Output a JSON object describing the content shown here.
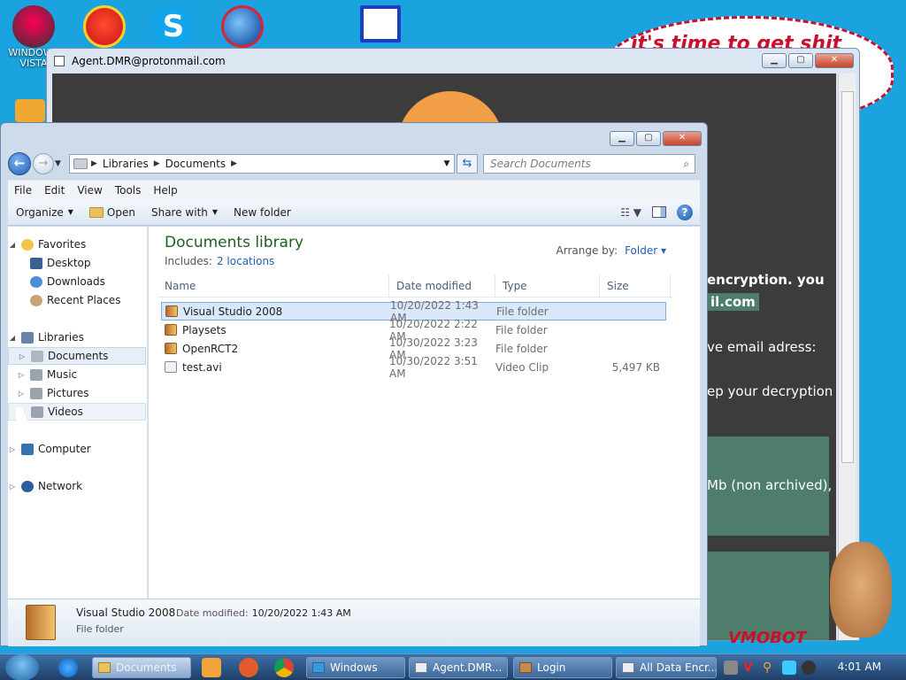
{
  "desktop": {
    "icons": [
      {
        "label": "WINDOWS VISTA"
      }
    ],
    "bubble_text": "it's time to get shit"
  },
  "ransom_window": {
    "title": "Agent.DMR@protonmail.com",
    "lines": [
      {
        "text": "encryption. you",
        "bold": true
      },
      {
        "text": "il.com",
        "bold": true
      },
      {
        "text": "ve email adress:"
      },
      {
        "text": "ep your decryption"
      },
      {
        "text": "Mb (non archived),"
      }
    ],
    "watermark": "VMOBOT"
  },
  "explorer": {
    "address": {
      "segments": [
        "Libraries",
        "Documents"
      ]
    },
    "search_placeholder": "Search Documents",
    "menu": [
      "File",
      "Edit",
      "View",
      "Tools",
      "Help"
    ],
    "commands": {
      "organize": "Organize",
      "open": "Open",
      "share": "Share with",
      "new_folder": "New folder"
    },
    "nav": {
      "favorites": "Favorites",
      "desktop": "Desktop",
      "downloads": "Downloads",
      "recent": "Recent Places",
      "libraries": "Libraries",
      "documents": "Documents",
      "music": "Music",
      "pictures": "Pictures",
      "videos": "Videos",
      "computer": "Computer",
      "network": "Network"
    },
    "library": {
      "title": "Documents library",
      "includes_label": "Includes:",
      "includes_link": "2 locations",
      "arrange_label": "Arrange by:",
      "arrange_value": "Folder"
    },
    "columns": [
      "Name",
      "Date modified",
      "Type",
      "Size"
    ],
    "files": [
      {
        "name": "Visual Studio 2008",
        "date": "10/20/2022 1:43 AM",
        "type": "File folder",
        "size": "",
        "kind": "folder"
      },
      {
        "name": "Playsets",
        "date": "10/20/2022 2:22 AM",
        "type": "File folder",
        "size": "",
        "kind": "folder"
      },
      {
        "name": "OpenRCT2",
        "date": "10/30/2022 3:23 AM",
        "type": "File folder",
        "size": "",
        "kind": "folder"
      },
      {
        "name": "test.avi",
        "date": "10/30/2022 3:51 AM",
        "type": "Video Clip",
        "size": "5,497 KB",
        "kind": "video"
      }
    ],
    "details": {
      "name": "Visual Studio 2008",
      "date_label": "Date modified:",
      "date_value": "10/20/2022 1:43 AM",
      "type": "File folder"
    }
  },
  "taskbar": {
    "buttons": [
      "Documents",
      "Windows",
      "Agent.DMR...",
      "Login",
      "All Data Encr..."
    ],
    "clock": "4:01 AM"
  }
}
